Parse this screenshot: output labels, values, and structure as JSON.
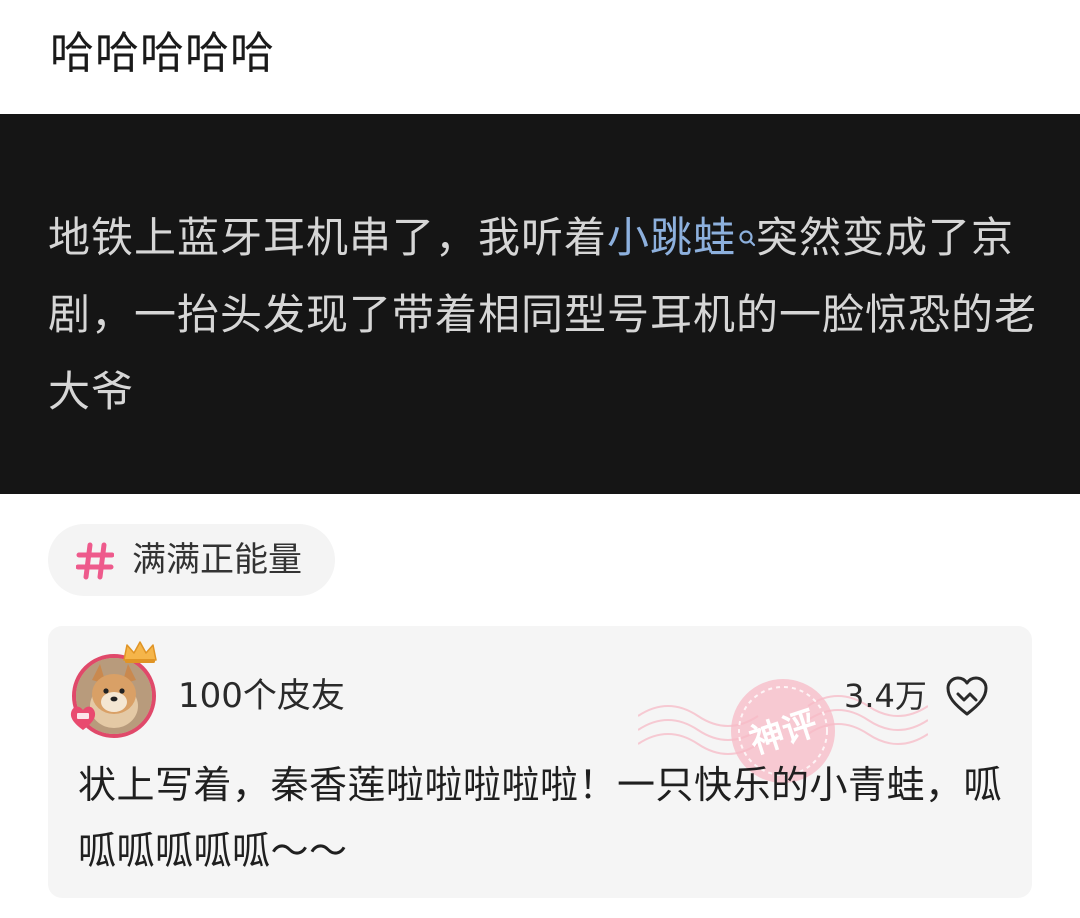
{
  "post": {
    "title": "哈哈哈哈哈"
  },
  "image": {
    "text_before": "地铁上蓝牙耳机串了，我听着",
    "link_text": "小跳蛙",
    "text_after": "突然变成了京剧，一抬头发现了带着相同型号耳机的一脸惊恐的老大爷",
    "link_icon": "search-icon"
  },
  "topic": {
    "icon": "hash-icon",
    "label": "满满正能量",
    "accent": "#ee5a8c"
  },
  "comment": {
    "username": "100个皮友",
    "likes": "3.4万",
    "like_icon": "heart-outline-icon",
    "badge_icon": "god-comment-badge-icon",
    "text": "状上写着，秦香莲啦啦啦啦啦！一只快乐的小青蛙，呱呱呱呱呱呱～～",
    "stamp_text": "神评",
    "stamp_color": "#f4a6b4"
  }
}
